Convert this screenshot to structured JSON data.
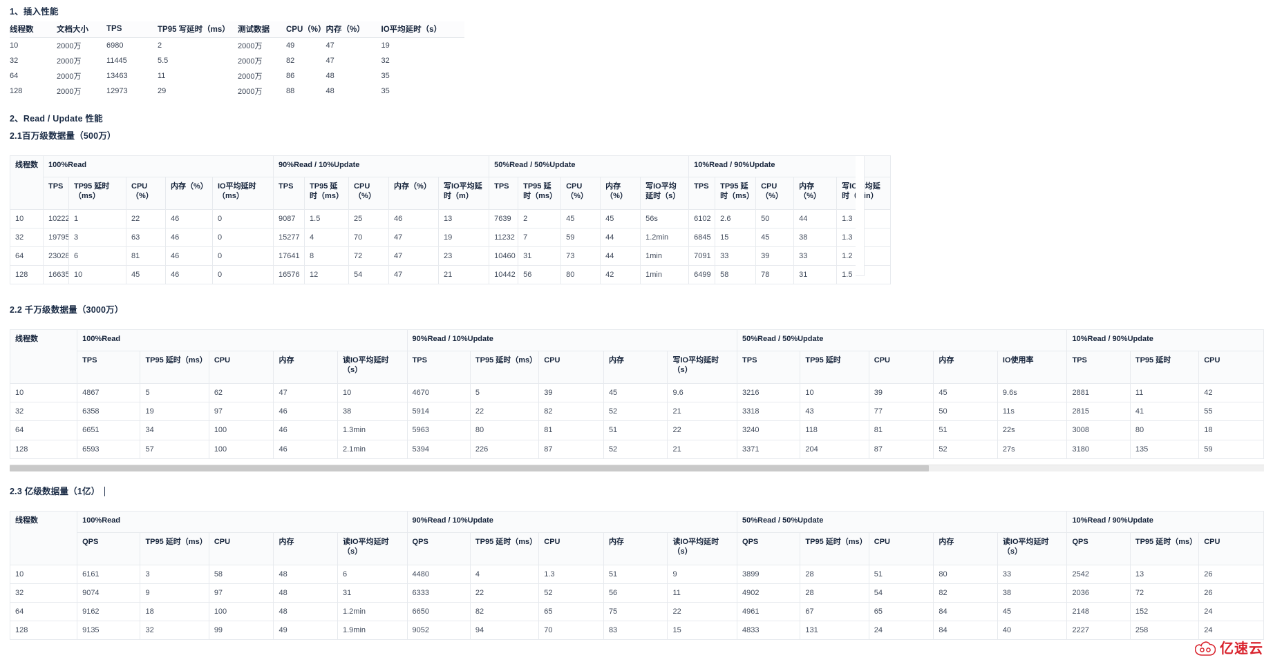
{
  "sections": {
    "insert_title": "1、插入性能",
    "read_update_title": "2、Read / Update 性能",
    "sub_21": "2.1百万级数据量（500万）",
    "sub_22": "2.2 千万级数据量（3000万）",
    "sub_23": "2.3 亿级数据量（1亿）"
  },
  "insert_table": {
    "headers": [
      "线程数",
      "文档大小",
      "TPS",
      "TP95 写延时（ms）",
      "测试数据",
      "CPU（%）",
      "内存（%）",
      "IO平均延时（s）"
    ],
    "rows": [
      [
        "10",
        "2000万",
        "6980",
        "2",
        "2000万",
        "49",
        "47",
        "19"
      ],
      [
        "32",
        "2000万",
        "11445",
        "5.5",
        "2000万",
        "82",
        "47",
        "32"
      ],
      [
        "64",
        "2000万",
        "13463",
        "11",
        "2000万",
        "86",
        "48",
        "35"
      ],
      [
        "128",
        "2000万",
        "12973",
        "29",
        "2000万",
        "88",
        "48",
        "35"
      ]
    ]
  },
  "table_21": {
    "thread_header": "线程数",
    "groups": [
      "100%Read",
      "90%Read / 10%Update",
      "50%Read / 50%Update",
      "10%Read / 90%Update"
    ],
    "subheaders": [
      "TPS",
      "TP95 延时（ms）",
      "CPU（%）",
      "内存（%）",
      "IO平均延时（ms）",
      "TPS",
      "TP95 延时（ms）",
      "CPU（%）",
      "内存（%）",
      "写IO平均延时（m）",
      "TPS",
      "TP95 延时（ms）",
      "CPU（%）",
      "内存（%）",
      "写IO平均延时（s）",
      "TPS",
      "TP95 延时（ms）",
      "CPU（%）",
      "内存（%）",
      "写IO平均延时（min）"
    ],
    "rows": [
      [
        "10",
        "10222",
        "1",
        "22",
        "46",
        "0",
        "9087",
        "1.5",
        "25",
        "46",
        "13",
        "7639",
        "2",
        "45",
        "45",
        "56s",
        "6102",
        "2.6",
        "50",
        "44",
        "1.3"
      ],
      [
        "32",
        "19795",
        "3",
        "63",
        "46",
        "0",
        "15277",
        "4",
        "70",
        "47",
        "19",
        "11232",
        "7",
        "59",
        "44",
        "1.2min",
        "6845",
        "15",
        "45",
        "38",
        "1.3"
      ],
      [
        "64",
        "23028",
        "6",
        "81",
        "46",
        "0",
        "17641",
        "8",
        "72",
        "47",
        "23",
        "10460",
        "31",
        "73",
        "44",
        "1min",
        "7091",
        "33",
        "39",
        "33",
        "1.2"
      ],
      [
        "128",
        "16635",
        "10",
        "45",
        "46",
        "0",
        "16576",
        "12",
        "54",
        "47",
        "21",
        "10442",
        "56",
        "80",
        "42",
        "1min",
        "6499",
        "58",
        "78",
        "31",
        "1.5"
      ]
    ]
  },
  "table_22": {
    "thread_header": "线程数",
    "groups": [
      "100%Read",
      "90%Read / 10%Update",
      "50%Read / 50%Update",
      "10%Read / 90%Update"
    ],
    "subheaders": [
      "TPS",
      "TP95 延时（ms）",
      "CPU",
      "内存",
      "读IO平均延时（s）",
      "TPS",
      "TP95 延时（ms）",
      "CPU",
      "内存",
      "写IO平均延时（s）",
      "TPS",
      "TP95 延时",
      "CPU",
      "内存",
      "IO使用率",
      "TPS",
      "TP95 延时",
      "CPU"
    ],
    "rows": [
      [
        "10",
        "4867",
        "5",
        "62",
        "47",
        "10",
        "4670",
        "5",
        "39",
        "45",
        "9.6",
        "3216",
        "10",
        "39",
        "45",
        "9.6s",
        "2881",
        "11",
        "42"
      ],
      [
        "32",
        "6358",
        "19",
        "97",
        "46",
        "38",
        "5914",
        "22",
        "82",
        "52",
        "21",
        "3318",
        "43",
        "77",
        "50",
        "11s",
        "2815",
        "41",
        "55"
      ],
      [
        "64",
        "6651",
        "34",
        "100",
        "46",
        "1.3min",
        "5963",
        "80",
        "81",
        "51",
        "22",
        "3240",
        "118",
        "81",
        "51",
        "22s",
        "3008",
        "80",
        "18"
      ],
      [
        "128",
        "6593",
        "57",
        "100",
        "46",
        "2.1min",
        "5394",
        "226",
        "87",
        "52",
        "21",
        "3371",
        "204",
        "87",
        "52",
        "27s",
        "3180",
        "135",
        "59"
      ]
    ]
  },
  "table_23": {
    "thread_header": "线程数",
    "groups": [
      "100%Read",
      "90%Read / 10%Update",
      "50%Read / 50%Update",
      "10%Read / 90%Update"
    ],
    "subheaders": [
      "QPS",
      "TP95 延时（ms）",
      "CPU",
      "内存",
      "读IO平均延时（s）",
      "QPS",
      "TP95 延时（ms）",
      "CPU",
      "内存",
      "读IO平均延时（s）",
      "QPS",
      "TP95 延时（ms）",
      "CPU",
      "内存",
      "读IO平均延时（s）",
      "QPS",
      "TP95 延时（ms）",
      "CPU"
    ],
    "rows": [
      [
        "10",
        "6161",
        "3",
        "58",
        "48",
        "6",
        "4480",
        "4",
        "1.3",
        "51",
        "9",
        "3899",
        "28",
        "51",
        "80",
        "33",
        "2542",
        "13",
        "26"
      ],
      [
        "32",
        "9074",
        "9",
        "97",
        "48",
        "31",
        "6333",
        "22",
        "52",
        "56",
        "11",
        "4902",
        "28",
        "54",
        "82",
        "38",
        "2036",
        "72",
        "26"
      ],
      [
        "64",
        "9162",
        "18",
        "100",
        "48",
        "1.2min",
        "6650",
        "82",
        "65",
        "75",
        "22",
        "4961",
        "67",
        "65",
        "84",
        "45",
        "2148",
        "152",
        "24"
      ],
      [
        "128",
        "9135",
        "32",
        "99",
        "49",
        "1.9min",
        "9052",
        "94",
        "70",
        "83",
        "15",
        "4833",
        "131",
        "24",
        "84",
        "40",
        "2227",
        "258",
        "24"
      ]
    ]
  },
  "watermark": {
    "text": "亿速云",
    "color": "#d9232d"
  }
}
